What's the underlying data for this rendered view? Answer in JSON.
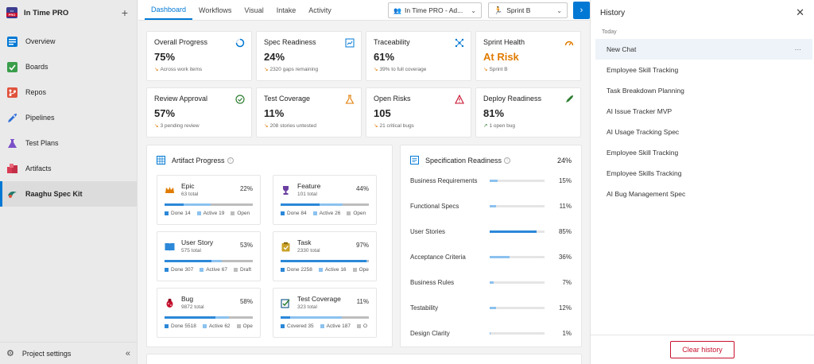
{
  "colors": {
    "accent": "#0078d4",
    "warning": "#e07b00",
    "danger": "#c8102e",
    "success": "#2e7d32",
    "done": "#2b88d8",
    "active": "#8cc2ef",
    "open": "#bdbdbd"
  },
  "sidebar": {
    "org_logo": "PRO",
    "org_name": "In Time PRO",
    "items": [
      {
        "label": "Overview",
        "icon": "overview-icon"
      },
      {
        "label": "Boards",
        "icon": "boards-icon"
      },
      {
        "label": "Repos",
        "icon": "repos-icon"
      },
      {
        "label": "Pipelines",
        "icon": "pipelines-icon"
      },
      {
        "label": "Test Plans",
        "icon": "test-plans-icon"
      },
      {
        "label": "Artifacts",
        "icon": "artifacts-icon"
      },
      {
        "label": "Raaghu Spec Kit",
        "icon": "spec-kit-icon"
      }
    ],
    "footer": "Project settings"
  },
  "topbar": {
    "tabs": [
      "Dashboard",
      "Workflows",
      "Visual",
      "Intake",
      "Activity"
    ],
    "project_select": "In Time PRO - Ad...",
    "sprint_select": "Sprint B"
  },
  "kpis": [
    {
      "title": "Overall Progress",
      "value": "75%",
      "sub": "Across work items",
      "trend": "down",
      "icon": "progress-ring-icon"
    },
    {
      "title": "Spec Readiness",
      "value": "24%",
      "sub": "2320 gaps remaining",
      "trend": "down",
      "icon": "spec-doc-icon"
    },
    {
      "title": "Traceability",
      "value": "61%",
      "sub": "39% to full coverage",
      "trend": "down",
      "icon": "network-icon"
    },
    {
      "title": "Sprint Health",
      "value": "At Risk",
      "sub": "Sprint B",
      "trend": "down",
      "icon": "gauge-icon"
    },
    {
      "title": "Review Approval",
      "value": "57%",
      "sub": "3 pending review",
      "trend": "down",
      "icon": "check-circle-icon"
    },
    {
      "title": "Test Coverage",
      "value": "11%",
      "sub": "208 stories untested",
      "trend": "down",
      "icon": "flask-icon"
    },
    {
      "title": "Open Risks",
      "value": "105",
      "sub": "21 critical bugs",
      "trend": "down",
      "icon": "warning-icon"
    },
    {
      "title": "Deploy Readiness",
      "value": "81%",
      "sub": "1 open bug",
      "trend": "up",
      "icon": "rocket-icon"
    }
  ],
  "artifact_progress": {
    "title": "Artifact Progress",
    "cards": [
      {
        "name": "Epic",
        "total": "63 total",
        "pct": "22%",
        "icon": "crown-icon",
        "done": 0.22,
        "active": 0.3,
        "legend": [
          "Done 14",
          "Active 19",
          "Open"
        ]
      },
      {
        "name": "Feature",
        "total": "101 total",
        "pct": "44%",
        "icon": "trophy-icon",
        "done": 0.44,
        "active": 0.26,
        "legend": [
          "Done 84",
          "Active 26",
          "Open"
        ]
      },
      {
        "name": "User Story",
        "total": "575 total",
        "pct": "53%",
        "icon": "book-icon",
        "done": 0.53,
        "active": 0.12,
        "legend": [
          "Done 307",
          "Active 67",
          "Draft"
        ]
      },
      {
        "name": "Task",
        "total": "2330 total",
        "pct": "97%",
        "icon": "clipboard-icon",
        "done": 0.97,
        "active": 0.01,
        "legend": [
          "Done 2258",
          "Active 16",
          "Ope"
        ]
      },
      {
        "name": "Bug",
        "total": "9872 total",
        "pct": "58%",
        "icon": "bug-icon",
        "done": 0.58,
        "active": 0.15,
        "legend": [
          "Done 5518",
          "Active 62",
          "Ope"
        ]
      },
      {
        "name": "Test Coverage",
        "total": "323 total",
        "pct": "11%",
        "icon": "test-check-icon",
        "done": 0.11,
        "active": 0.58,
        "legend": [
          "Covered 35",
          "Active 187",
          "O"
        ]
      }
    ]
  },
  "spec_readiness": {
    "title": "Specification Readiness",
    "total": "24%",
    "rows": [
      {
        "label": "Business Requirements",
        "pct": "15%",
        "value": 0.15
      },
      {
        "label": "Functional Specs",
        "pct": "11%",
        "value": 0.11
      },
      {
        "label": "User Stories",
        "pct": "85%",
        "value": 0.85
      },
      {
        "label": "Acceptance Criteria",
        "pct": "36%",
        "value": 0.36
      },
      {
        "label": "Business Rules",
        "pct": "7%",
        "value": 0.07
      },
      {
        "label": "Testability",
        "pct": "12%",
        "value": 0.12
      },
      {
        "label": "Design Clarity",
        "pct": "1%",
        "value": 0.01
      }
    ]
  },
  "history": {
    "title": "History",
    "section": "Today",
    "items": [
      "New Chat",
      "Employee Skill Tracking",
      "Task Breakdown Planning",
      "AI Issue Tracker MVP",
      "AI Usage Tracking Spec",
      "Employee Skill Tracking",
      "Employee Skills Tracking",
      "AI Bug Management Spec"
    ],
    "clear_label": "Clear history"
  }
}
